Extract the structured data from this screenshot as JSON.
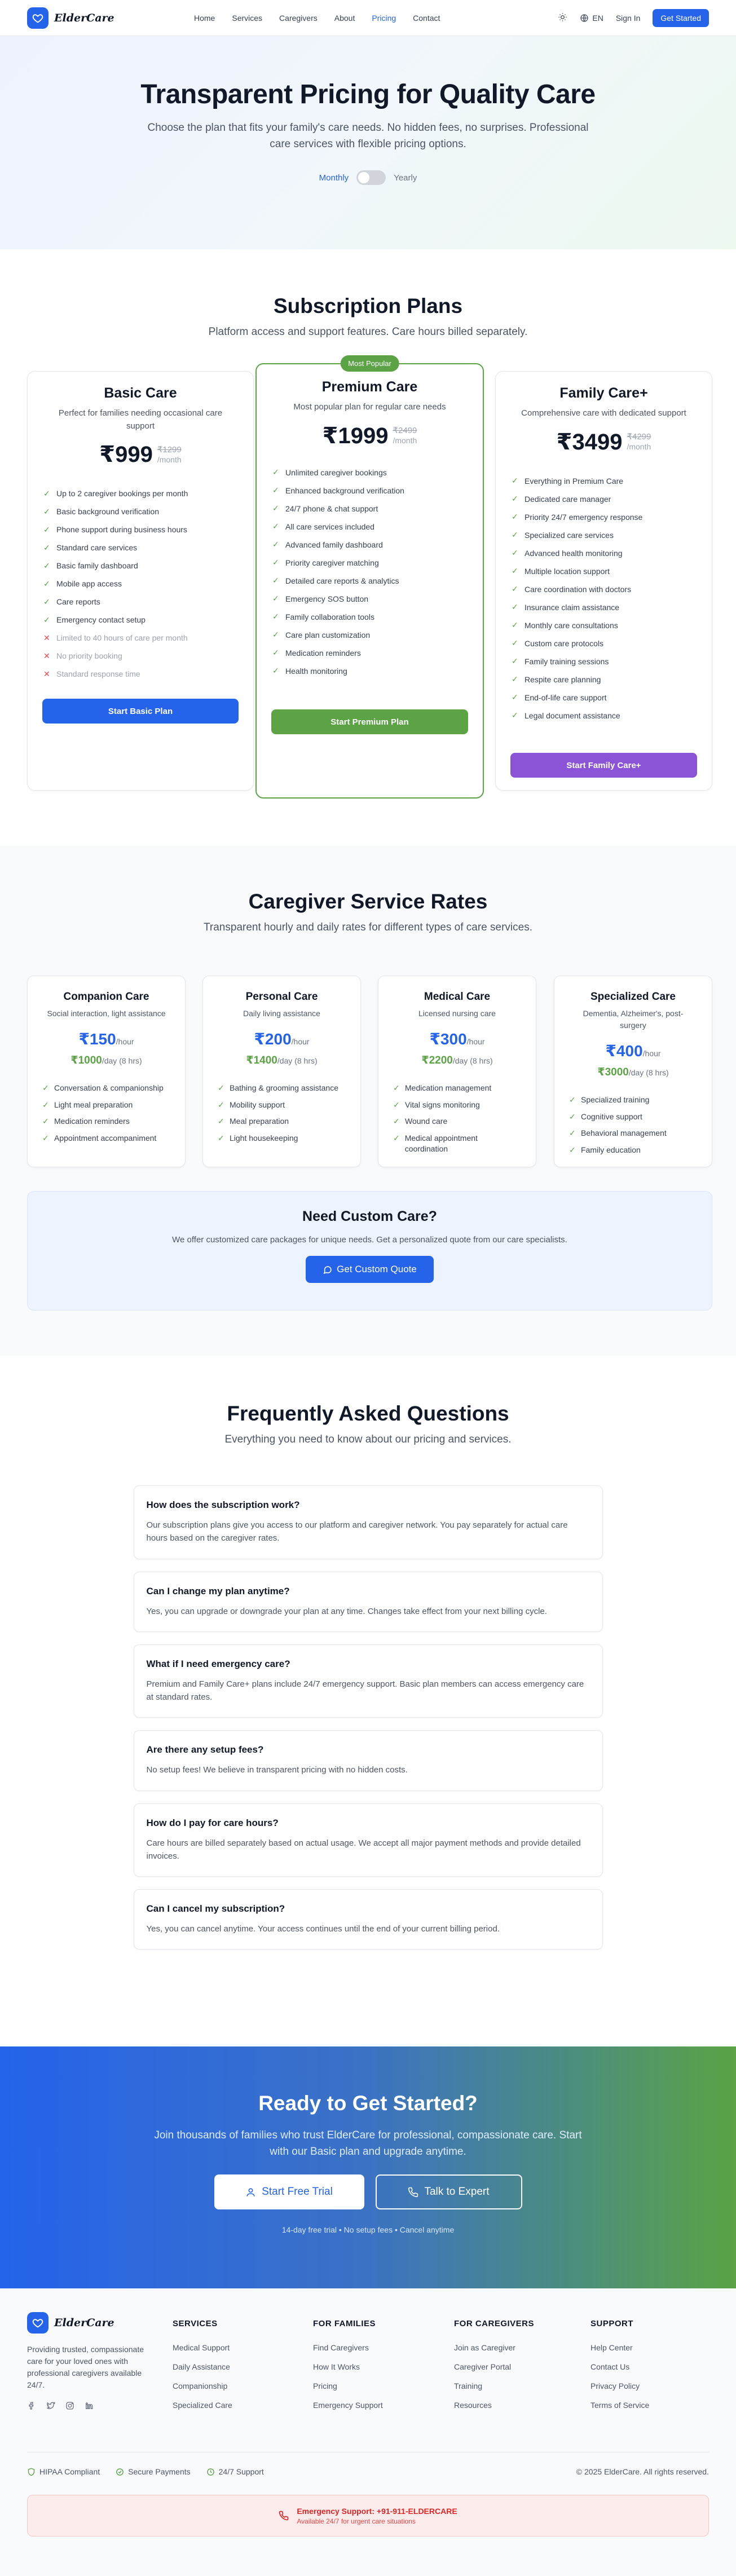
{
  "nav": {
    "brand": "ElderCare",
    "links": [
      {
        "label": "Home",
        "active": false
      },
      {
        "label": "Services",
        "active": false
      },
      {
        "label": "Caregivers",
        "active": false
      },
      {
        "label": "About",
        "active": false
      },
      {
        "label": "Pricing",
        "active": true
      },
      {
        "label": "Contact",
        "active": false
      }
    ],
    "language": "EN",
    "sign_in": "Sign In",
    "get_started": "Get Started",
    "theme_icon": "sun-icon",
    "accent": "#2563eb"
  },
  "hero": {
    "title": "Transparent Pricing for Quality Care",
    "subtitle": "Choose the plan that fits your family's care needs. No hidden fees, no surprises. Professional care services with flexible pricing options.",
    "toggle": {
      "left": "Monthly",
      "right": "Yearly",
      "selected": "Monthly"
    }
  },
  "subscription": {
    "title": "Subscription Plans",
    "subtitle": "Platform access and support features. Care hours billed separately.",
    "plans": [
      {
        "name": "Basic Care",
        "description": "Perfect for families needing occasional care support",
        "price": "₹999",
        "original_price": "₹1299",
        "period": "/month",
        "features": [
          {
            "text": "Up to 2 caregiver bookings per month",
            "included": true
          },
          {
            "text": "Basic background verification",
            "included": true
          },
          {
            "text": "Phone support during business hours",
            "included": true
          },
          {
            "text": "Standard care services",
            "included": true
          },
          {
            "text": "Basic family dashboard",
            "included": true
          },
          {
            "text": "Mobile app access",
            "included": true
          },
          {
            "text": "Care reports",
            "included": true
          },
          {
            "text": "Emergency contact setup",
            "included": true
          },
          {
            "text": "Limited to 40 hours of care per month",
            "included": false
          },
          {
            "text": "No priority booking",
            "included": false
          },
          {
            "text": "Standard response time",
            "included": false
          }
        ],
        "button": "Start Basic Plan",
        "button_color": "#2563eb"
      },
      {
        "name": "Premium Care",
        "badge": "Most Popular",
        "description": "Most popular plan for regular care needs",
        "price": "₹1999",
        "original_price": "₹2499",
        "period": "/month",
        "features": [
          {
            "text": "Unlimited caregiver bookings",
            "included": true
          },
          {
            "text": "Enhanced background verification",
            "included": true
          },
          {
            "text": "24/7 phone & chat support",
            "included": true
          },
          {
            "text": "All care services included",
            "included": true
          },
          {
            "text": "Advanced family dashboard",
            "included": true
          },
          {
            "text": "Priority caregiver matching",
            "included": true
          },
          {
            "text": "Detailed care reports & analytics",
            "included": true
          },
          {
            "text": "Emergency SOS button",
            "included": true
          },
          {
            "text": "Family collaboration tools",
            "included": true
          },
          {
            "text": "Care plan customization",
            "included": true
          },
          {
            "text": "Medication reminders",
            "included": true
          },
          {
            "text": "Health monitoring",
            "included": true
          }
        ],
        "button": "Start Premium Plan",
        "button_color": "#5ba345"
      },
      {
        "name": "Family Care+",
        "description": "Comprehensive care with dedicated support",
        "price": "₹3499",
        "original_price": "₹4299",
        "period": "/month",
        "features": [
          {
            "text": "Everything in Premium Care",
            "included": true
          },
          {
            "text": "Dedicated care manager",
            "included": true
          },
          {
            "text": "Priority 24/7 emergency response",
            "included": true
          },
          {
            "text": "Specialized care services",
            "included": true
          },
          {
            "text": "Advanced health monitoring",
            "included": true
          },
          {
            "text": "Multiple location support",
            "included": true
          },
          {
            "text": "Care coordination with doctors",
            "included": true
          },
          {
            "text": "Insurance claim assistance",
            "included": true
          },
          {
            "text": "Monthly care consultations",
            "included": true
          },
          {
            "text": "Custom care protocols",
            "included": true
          },
          {
            "text": "Family training sessions",
            "included": true
          },
          {
            "text": "Respite care planning",
            "included": true
          },
          {
            "text": "End-of-life care support",
            "included": true
          },
          {
            "text": "Legal document assistance",
            "included": true
          }
        ],
        "button": "Start Family Care+",
        "button_color": "#8b54d8"
      }
    ]
  },
  "rates": {
    "title": "Caregiver Service Rates",
    "subtitle": "Transparent hourly and daily rates for different types of care services.",
    "cards": [
      {
        "name": "Companion Care",
        "desc": "Social interaction, light assistance",
        "hourly": "₹150",
        "hour_unit": "/hour",
        "daily": "₹1000",
        "day_unit": "/day (8 hrs)",
        "items": [
          "Conversation & companionship",
          "Light meal preparation",
          "Medication reminders",
          "Appointment accompaniment"
        ]
      },
      {
        "name": "Personal Care",
        "desc": "Daily living assistance",
        "hourly": "₹200",
        "hour_unit": "/hour",
        "daily": "₹1400",
        "day_unit": "/day (8 hrs)",
        "items": [
          "Bathing & grooming assistance",
          "Mobility support",
          "Meal preparation",
          "Light housekeeping"
        ]
      },
      {
        "name": "Medical Care",
        "desc": "Licensed nursing care",
        "hourly": "₹300",
        "hour_unit": "/hour",
        "daily": "₹2200",
        "day_unit": "/day (8 hrs)",
        "items": [
          "Medication management",
          "Vital signs monitoring",
          "Wound care",
          "Medical appointment coordination"
        ]
      },
      {
        "name": "Specialized Care",
        "desc": "Dementia, Alzheimer's, post-surgery",
        "hourly": "₹400",
        "hour_unit": "/hour",
        "daily": "₹3000",
        "day_unit": "/day (8 hrs)",
        "items": [
          "Specialized training",
          "Cognitive support",
          "Behavioral management",
          "Family education"
        ]
      }
    ],
    "custom": {
      "title": "Need Custom Care?",
      "text": "We offer customized care packages for unique needs. Get a personalized quote from our care specialists.",
      "button": "Get Custom Quote"
    }
  },
  "faq": {
    "title": "Frequently Asked Questions",
    "subtitle": "Everything you need to know about our pricing and services.",
    "items": [
      {
        "q": "How does the subscription work?",
        "a": "Our subscription plans give you access to our platform and caregiver network. You pay separately for actual care hours based on the caregiver rates."
      },
      {
        "q": "Can I change my plan anytime?",
        "a": "Yes, you can upgrade or downgrade your plan at any time. Changes take effect from your next billing cycle."
      },
      {
        "q": "What if I need emergency care?",
        "a": "Premium and Family Care+ plans include 24/7 emergency support. Basic plan members can access emergency care at standard rates."
      },
      {
        "q": "Are there any setup fees?",
        "a": "No setup fees! We believe in transparent pricing with no hidden costs."
      },
      {
        "q": "How do I pay for care hours?",
        "a": "Care hours are billed separately based on actual usage. We accept all major payment methods and provide detailed invoices."
      },
      {
        "q": "Can I cancel my subscription?",
        "a": "Yes, you can cancel anytime. Your access continues until the end of your current billing period."
      }
    ]
  },
  "cta": {
    "title": "Ready to Get Started?",
    "text": "Join thousands of families who trust ElderCare for professional, compassionate care. Start with our Basic plan and upgrade anytime.",
    "primary": "Start Free Trial",
    "secondary": "Talk to Expert",
    "note": "14-day free trial • No setup fees • Cancel anytime"
  },
  "footer": {
    "brand": "ElderCare",
    "tagline": "Providing trusted, compassionate care for your loved ones with professional caregivers available 24/7.",
    "social_icons": [
      "facebook-icon",
      "twitter-icon",
      "instagram-icon",
      "linkedin-icon"
    ],
    "columns": [
      {
        "title": "SERVICES",
        "links": [
          "Medical Support",
          "Daily Assistance",
          "Companionship",
          "Specialized Care"
        ]
      },
      {
        "title": "FOR FAMILIES",
        "links": [
          "Find Caregivers",
          "How It Works",
          "Pricing",
          "Emergency Support"
        ]
      },
      {
        "title": "FOR CAREGIVERS",
        "links": [
          "Join as Caregiver",
          "Caregiver Portal",
          "Training",
          "Resources"
        ]
      },
      {
        "title": "SUPPORT",
        "links": [
          "Help Center",
          "Contact Us",
          "Privacy Policy",
          "Terms of Service"
        ]
      }
    ],
    "trust": [
      "HIPAA Compliant",
      "Secure Payments",
      "24/7 Support"
    ],
    "copyright": "© 2025 ElderCare. All rights reserved.",
    "emergency": {
      "title": "Emergency Support: +91-911-ELDERCARE",
      "sub": "Available 24/7 for urgent care situations"
    }
  }
}
